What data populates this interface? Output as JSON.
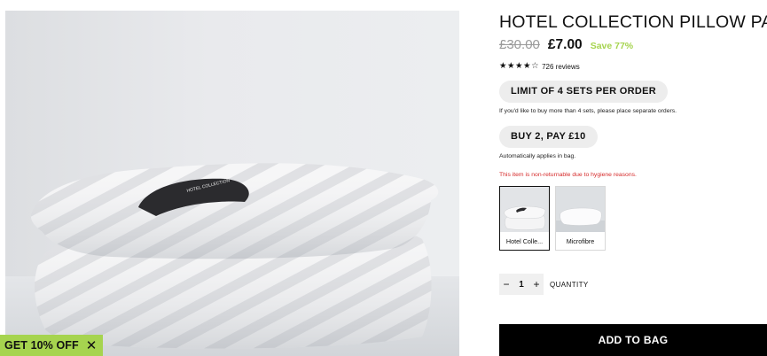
{
  "product": {
    "title": "HOTEL COLLECTION PILLOW PAIR",
    "price_old": "£30.00",
    "price_new": "£7.00",
    "savings": "Save 77%",
    "rating_stars": "★★★★☆",
    "reviews": "726 reviews",
    "image_label": "HOTEL COLLECTION"
  },
  "offers": {
    "limit_label": "LIMIT OF 4 SETS PER ORDER",
    "limit_note": "If you'd like to buy more than 4 sets, please place separate orders.",
    "buy2_label": "BUY 2, PAY £10",
    "buy2_note": "Automatically applies in bag.",
    "warning": "This item is non-returnable due to hygiene reasons."
  },
  "variants": [
    {
      "label": "Hotel Colle...",
      "selected": true
    },
    {
      "label": "Microfibre",
      "selected": false
    }
  ],
  "quantity": {
    "minus": "−",
    "value": "1",
    "plus": "+",
    "label": "QUANTITY"
  },
  "cta": {
    "add_to_bag": "ADD TO BAG"
  },
  "promo": {
    "label": "GET 10% OFF",
    "close": "✕"
  },
  "colors": {
    "accent_green": "#a6d44f",
    "warning_red": "#d62b2b",
    "button_black": "#000000",
    "pill_grey": "#ededed"
  }
}
